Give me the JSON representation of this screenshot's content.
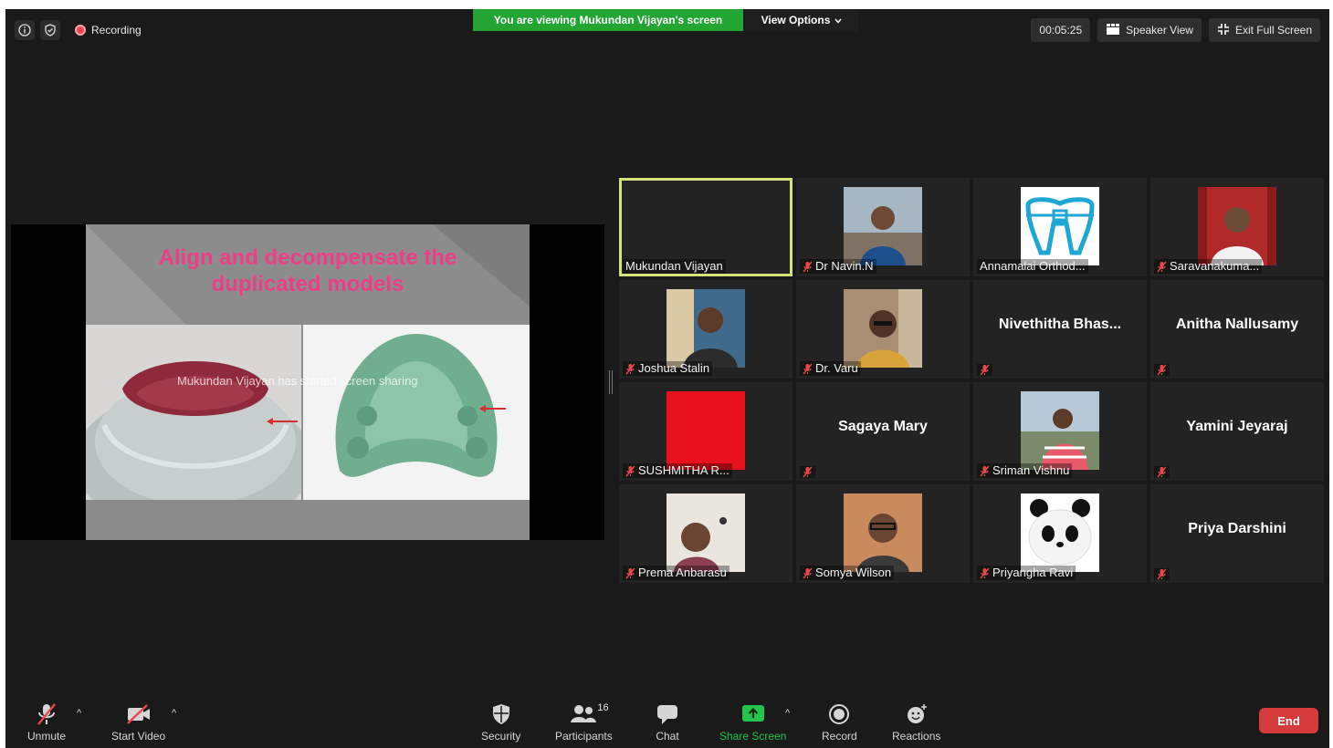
{
  "top_bar": {
    "recording_label": "Recording",
    "banner_text": "You are viewing Mukundan Vijayan's screen",
    "view_options_label": "View Options",
    "timer": "00:05:25",
    "speaker_view_label": "Speaker View",
    "exit_full_screen_label": "Exit Full Screen"
  },
  "shared_screen": {
    "slide_title_line1": "Align and decompensate the",
    "slide_title_line2": "duplicated models",
    "sharer_notice": "Mukundan Vijayan has started screen sharing"
  },
  "participants": [
    {
      "name": "Mukundan Vijayan",
      "muted": false,
      "display": "video",
      "active": true
    },
    {
      "name": "Dr Navin.N",
      "muted": true,
      "display": "video"
    },
    {
      "name": "Annamalai Orthod...",
      "muted": false,
      "display": "video"
    },
    {
      "name": "Saravanakuma...",
      "muted": true,
      "display": "video"
    },
    {
      "name": "Joshua Stalin",
      "muted": true,
      "display": "video"
    },
    {
      "name": "Dr. Varu",
      "muted": true,
      "display": "video"
    },
    {
      "name": "Nivethitha  Bhas...",
      "muted": true,
      "display": "name"
    },
    {
      "name": "Anitha Nallusamy",
      "muted": true,
      "display": "name"
    },
    {
      "name": "SUSHMITHA R...",
      "muted": true,
      "display": "video"
    },
    {
      "name": "Sagaya Mary",
      "muted": true,
      "display": "name"
    },
    {
      "name": "Sriman Vishnu",
      "muted": true,
      "display": "video"
    },
    {
      "name": "Yamini Jeyaraj",
      "muted": true,
      "display": "name"
    },
    {
      "name": "Prema Anbarasu",
      "muted": true,
      "display": "video"
    },
    {
      "name": "Somya Wilson",
      "muted": true,
      "display": "video"
    },
    {
      "name": "Priyangha Ravi",
      "muted": true,
      "display": "video"
    },
    {
      "name": "Priya Darshini",
      "muted": true,
      "display": "name"
    }
  ],
  "toolbar": {
    "unmute_label": "Unmute",
    "start_video_label": "Start Video",
    "security_label": "Security",
    "participants_label": "Participants",
    "participants_count": "16",
    "chat_label": "Chat",
    "share_screen_label": "Share Screen",
    "record_label": "Record",
    "reactions_label": "Reactions",
    "end_label": "End"
  },
  "colors": {
    "banner_green": "#23a534",
    "active_speaker_border": "#d5e27a",
    "end_red": "#d63a3a",
    "muted_mic_red": "#e8484d",
    "slide_title_pink": "#ee3f86"
  }
}
